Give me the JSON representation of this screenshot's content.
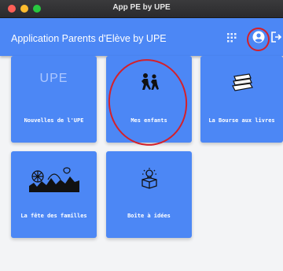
{
  "window": {
    "title": "App PE by UPE"
  },
  "appbar": {
    "title": "Application Parents d'Elève by UPE",
    "actions": [
      "apps-grid-icon",
      "account-circle-icon",
      "logout-icon"
    ]
  },
  "tiles": [
    {
      "label": "Nouvelles de l'UPE",
      "icon": "upe-logo",
      "logo_text": "UPE"
    },
    {
      "label": "Mes enfants",
      "icon": "children-icon"
    },
    {
      "label": "La Bourse aux livres",
      "icon": "books-icon"
    },
    {
      "label": "La fête des familles",
      "icon": "fairground-icon"
    },
    {
      "label": "Boîte à idées",
      "icon": "idea-box-icon"
    }
  ],
  "colors": {
    "primary": "#4c87f5",
    "background": "#f3f4f6",
    "annotation": "#d4202a"
  }
}
